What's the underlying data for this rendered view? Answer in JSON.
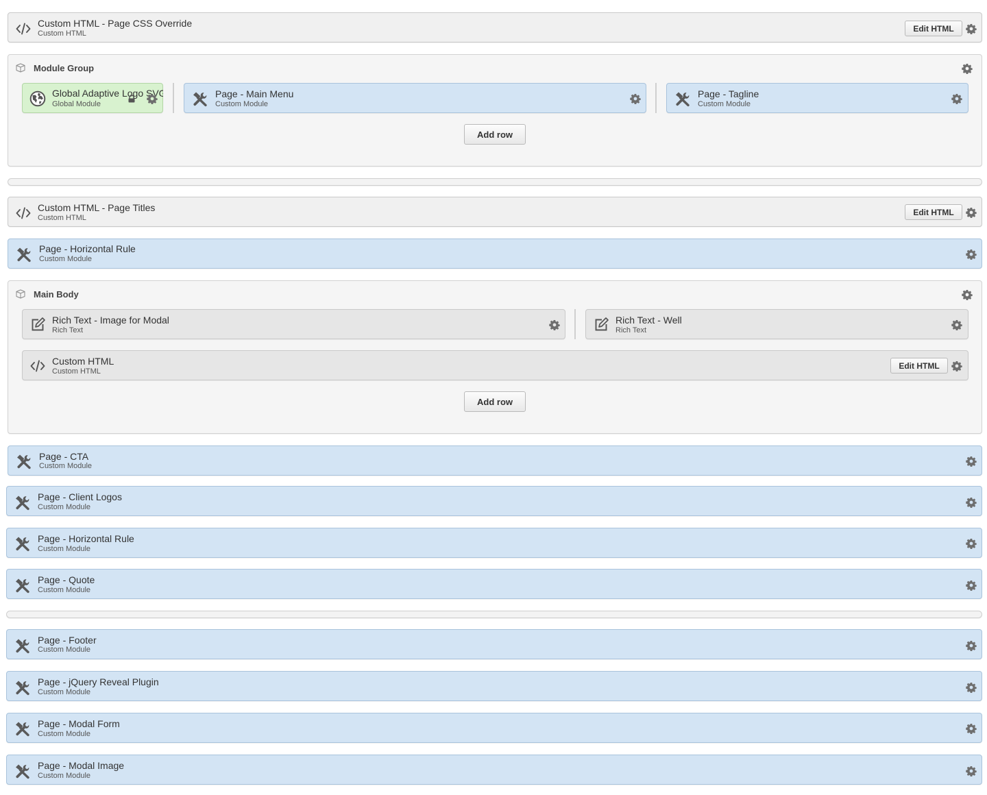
{
  "blocks": {
    "css_override": {
      "title": "Custom HTML - Page CSS Override",
      "subtitle": "Custom HTML",
      "edit_label": "Edit HTML"
    },
    "module_group": {
      "title": "Module Group",
      "global_logo": {
        "title": "Global Adaptive Logo SVG",
        "subtitle": "Global Module"
      },
      "main_menu": {
        "title": "Page - Main Menu",
        "subtitle": "Custom Module"
      },
      "tagline": {
        "title": "Page - Tagline",
        "subtitle": "Custom Module"
      },
      "add_row_label": "Add row"
    },
    "page_titles": {
      "title": "Custom HTML - Page Titles",
      "subtitle": "Custom HTML",
      "edit_label": "Edit HTML"
    },
    "horizontal_rule_1": {
      "title": "Page - Horizontal Rule",
      "subtitle": "Custom Module"
    },
    "main_body": {
      "title": "Main Body",
      "image_modal": {
        "title": "Rich Text - Image for Modal",
        "subtitle": "Rich Text"
      },
      "well": {
        "title": "Rich Text - Well",
        "subtitle": "Rich Text"
      },
      "custom_html": {
        "title": "Custom HTML",
        "subtitle": "Custom HTML",
        "edit_label": "Edit HTML"
      },
      "add_row_label": "Add row"
    },
    "cta": {
      "title": "Page - CTA",
      "subtitle": "Custom Module"
    },
    "client_logos": {
      "title": "Page - Client Logos",
      "subtitle": "Custom Module"
    },
    "horizontal_rule_2": {
      "title": "Page - Horizontal Rule",
      "subtitle": "Custom Module"
    },
    "quote": {
      "title": "Page - Quote",
      "subtitle": "Custom Module"
    },
    "footer": {
      "title": "Page - Footer",
      "subtitle": "Custom Module"
    },
    "jquery_reveal": {
      "title": "Page - jQuery Reveal Plugin",
      "subtitle": "Custom Module"
    },
    "modal_form": {
      "title": "Page - Modal Form",
      "subtitle": "Custom Module"
    },
    "modal_image": {
      "title": "Page - Modal Image",
      "subtitle": "Custom Module"
    }
  },
  "colors": {
    "custom_module_bg": "#d3e4f4",
    "global_module_bg": "#d8f2cf",
    "custom_html_bg": "#f0f0f0",
    "rich_text_bg": "#e6e6e6"
  },
  "icons": {
    "custom_html": "code-icon",
    "custom_module": "tools-icon",
    "global_module": "globe-icon",
    "rich_text": "edit-icon",
    "group": "box-icon",
    "settings": "gear-icon",
    "locked": "lock-icon"
  }
}
